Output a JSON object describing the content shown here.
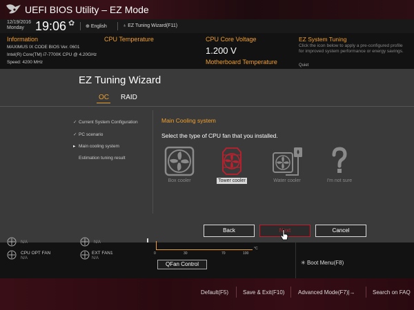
{
  "app": {
    "title": "UEFI BIOS Utility – EZ Mode"
  },
  "header": {
    "date": "12/19/2016",
    "day": "Monday",
    "time": "19:06",
    "language": "English",
    "wizard": "EZ Tuning Wizard(F11)"
  },
  "info": {
    "title": "Information",
    "lines": [
      "MAXIMUS IX CODE   BIOS Ver. 0601",
      "Intel(R) Core(TM) i7-7700K CPU @ 4.20GHz",
      "Speed: 4200 MHz"
    ]
  },
  "cpu_temp": {
    "title": "CPU Temperature"
  },
  "cpu_voltage": {
    "title": "CPU Core Voltage",
    "value": "1.200 V"
  },
  "mb_temp": {
    "title": "Motherboard Temperature"
  },
  "ez_system": {
    "title": "EZ System Tuning",
    "desc": "Click the icon below to apply a pre-configured profile for improved system performance or energy savings.",
    "mode": "Quiet"
  },
  "wizard": {
    "title": "EZ Tuning Wizard",
    "tabs": [
      "OC",
      "RAID"
    ],
    "active_tab": "OC",
    "steps": [
      {
        "label": "Current System Configuration",
        "mark": "✓"
      },
      {
        "label": "PC scenario",
        "mark": "✓"
      },
      {
        "label": "Main cooling system",
        "mark": "▸"
      },
      {
        "label": "Estimation tuning result",
        "mark": ""
      }
    ],
    "section_title": "Main Cooling system",
    "question": "Select the type of CPU fan that you installed.",
    "options": [
      {
        "label": "Box cooler",
        "icon": "box-cooler-icon"
      },
      {
        "label": "Tower cooler",
        "icon": "tower-cooler-icon"
      },
      {
        "label": "Water cooler",
        "icon": "water-cooler-icon"
      },
      {
        "label": "I'm not sure",
        "icon": "question-icon"
      }
    ],
    "selected": "Tower cooler",
    "buttons": {
      "back": "Back",
      "next": "Next",
      "cancel": "Cancel"
    },
    "accent": "#c0202e",
    "orange": "#f0a030"
  },
  "fans": {
    "na": "N/A",
    "cpu_opt": "CPU OPT FAN",
    "ext1": "EXT FAN1",
    "axis": [
      "0",
      "30",
      "70",
      "100"
    ],
    "unit": "°C",
    "qfan": "QFan Control"
  },
  "boot_menu": "Boot Menu(F8)",
  "footer": {
    "default": "Default(F5)",
    "save_exit": "Save & Exit(F10)",
    "advanced": "Advanced Mode(F7)|→",
    "search": "Search on FAQ"
  }
}
